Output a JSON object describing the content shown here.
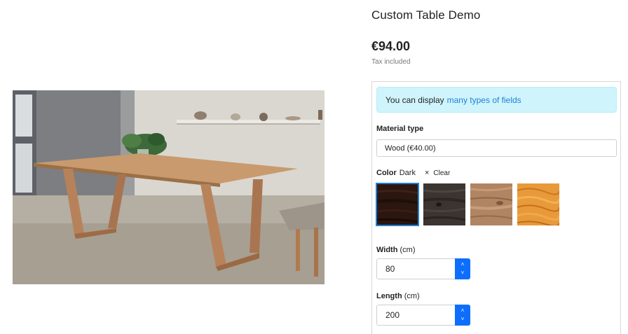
{
  "product": {
    "title": "Custom Table Demo",
    "price": "€94.00",
    "tax_label": "Tax included",
    "image_alt": "Wooden dining table"
  },
  "custom_fields": {
    "alert": {
      "prefix": "You can display",
      "link": "many types of fields"
    },
    "material": {
      "label": "Material type",
      "value": "Wood (€40.00)"
    },
    "color": {
      "label": "Color",
      "value": "Dark",
      "clear_label": "Clear",
      "clear_icon": "×",
      "swatches": [
        {
          "name": "dark-walnut",
          "selected": true
        },
        {
          "name": "dark-grey-wood",
          "selected": false
        },
        {
          "name": "light-oak",
          "selected": false
        },
        {
          "name": "pine",
          "selected": false
        }
      ]
    },
    "width": {
      "label": "Width",
      "unit": "(cm)",
      "value": "80"
    },
    "length": {
      "label": "Length",
      "unit": "(cm)",
      "value": "200"
    }
  },
  "icons": {
    "step_up": "˄",
    "step_down": "˅"
  },
  "colors": {
    "accent": "#0d6efd",
    "link": "#1f7fd6",
    "alert_bg": "#cff4fc"
  }
}
